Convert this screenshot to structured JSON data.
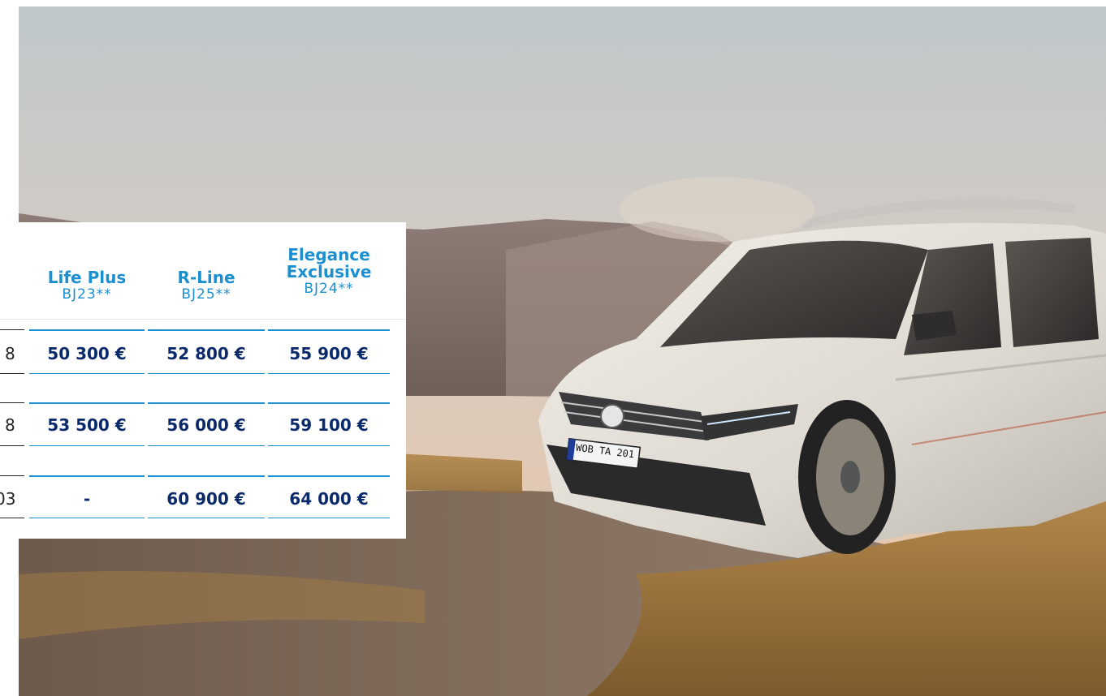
{
  "hero": {
    "alt": "White SUV driving fast on a dusty desert road at sunset"
  },
  "vehicle": {
    "plate": "WOB TA 201"
  },
  "table": {
    "columns": [
      {
        "name": "Life Plus",
        "year": "BJ23**"
      },
      {
        "name": "R-Line",
        "year": "BJ25**"
      },
      {
        "name": "Elegance Exclusive",
        "year": "BJ24**"
      }
    ],
    "rows": [
      {
        "label": "8",
        "values": [
          "50 300 €",
          "52 800 €",
          "55 900 €"
        ]
      },
      {
        "label": "8",
        "values": [
          "53 500 €",
          "56 000 €",
          "59 100 €"
        ]
      },
      {
        "label": "03",
        "values": [
          "-",
          "60 900 €",
          "64 000 €"
        ]
      }
    ]
  },
  "colors": {
    "accent": "#1b8fd0",
    "price": "#0b2a6b"
  }
}
